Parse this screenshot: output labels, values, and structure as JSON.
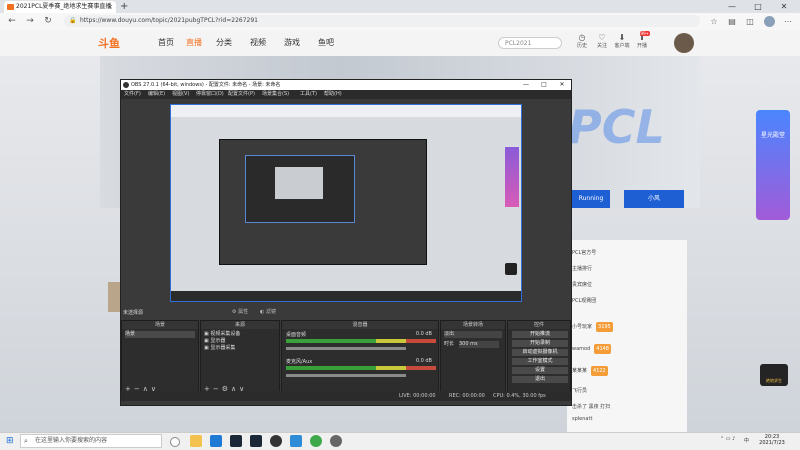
{
  "browser": {
    "tab_title": "2021PCL夏季赛_绝地求生赛事直播",
    "tab_close": "×",
    "new_tab": "+",
    "url": "https://www.douyu.com/topic/2021pubgTPCL?rid=2267291",
    "win_min": "—",
    "win_max": "□",
    "win_close": "✕"
  },
  "site": {
    "logo": "斗鱼",
    "nav": [
      "首页",
      "直播",
      "分类",
      "视频",
      "游戏",
      "鱼吧"
    ],
    "search_placeholder": "PCL2021",
    "header_icons": [
      {
        "name": "history",
        "label": "历史"
      },
      {
        "name": "follow",
        "label": "关注"
      },
      {
        "name": "download",
        "label": "客户端"
      },
      {
        "name": "upload",
        "label": "开播"
      }
    ],
    "header_badge": "99+",
    "banner_text": "PCL",
    "banner_btn_1": "Running",
    "banner_btn_2": "小风",
    "side_promo": "星光殿堂",
    "right_rows": [
      {
        "text": "PCL官方号",
        "badge": ""
      },
      {
        "text": "主播排行",
        "badge": ""
      },
      {
        "text": "贵宾席位",
        "badge": ""
      },
      {
        "text": "PCL观赛团",
        "badge": ""
      },
      {
        "text": "小号玩家",
        "badge": "3195"
      },
      {
        "text": "wamod",
        "badge": "4148"
      },
      {
        "text": "某某某",
        "badge": "4122"
      },
      {
        "text": "飞行员",
        "badge": ""
      },
      {
        "text": "击杀了 黑夜 打扫",
        "badge": ""
      },
      {
        "text": "splenatt",
        "badge": ""
      }
    ],
    "game_badge": "绝地求生"
  },
  "obs": {
    "title": "OBS 27.0.1 (64-bit, windows) - 配置文件: 未命名 - 场景: 未命名",
    "menu": [
      "文件(F)",
      "编辑(E)",
      "视图(V)",
      "停靠窗口(D)",
      "配置文件(P)",
      "场景集合(S)",
      "工具(T)",
      "帮助(H)"
    ],
    "scene_label": "未选择源",
    "props_tab": "属性",
    "filters_tab": "滤镜",
    "docks": {
      "scenes": {
        "header": "场景",
        "items": [
          "场景"
        ]
      },
      "sources": {
        "header": "来源",
        "items": [
          "视频采集设备",
          "显示器",
          "显示器采集"
        ]
      },
      "mixer": {
        "header": "混音器",
        "tracks": [
          {
            "name": "桌面音频",
            "db": "0.0 dB"
          },
          {
            "name": "麦克风/Aux",
            "db": "0.0 dB"
          }
        ]
      },
      "transitions": {
        "header": "场景转场",
        "type": "淡出",
        "duration_label": "时长",
        "duration": "300 ms"
      },
      "controls": {
        "header": "控件",
        "buttons": [
          "开始推流",
          "开始录制",
          "启动虚拟摄像机",
          "工作室模式",
          "设置",
          "退出"
        ]
      }
    },
    "status": {
      "live": "LIVE: 00:00:00",
      "rec": "REC: 00:00:00",
      "cpu": "CPU: 0.4%, 30.00 fps"
    }
  },
  "taskbar": {
    "search_placeholder": "在这里输入你要搜索的内容",
    "apps": [
      "file-explorer",
      "edge",
      "steam",
      "obs",
      "chrome",
      "mail"
    ],
    "time": "20:23",
    "date": "2021/7/23",
    "lang": "中"
  },
  "colors": {
    "accent_orange": "#f37021",
    "obs_bg": "#3a3a3a",
    "preview_border": "#2f6fd6",
    "banner_blue": "#1e5fd4"
  }
}
